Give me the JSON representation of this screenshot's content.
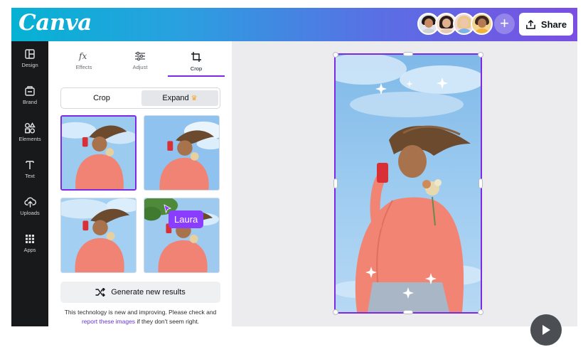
{
  "header": {
    "logo": "Canva",
    "gradient_start": "#05b2d3",
    "gradient_end": "#7a4fe2",
    "share_label": "Share",
    "share_icon": "upload-icon",
    "add_collaborator_icon": "plus-icon",
    "collaborators": [
      {
        "hair": "#1f1a17",
        "shirt": "#cfd3d8",
        "ring": "#f1a7b8"
      },
      {
        "hair": "#2a1e1a",
        "shirt": "#e8c8b8",
        "ring": "#f3c68a"
      },
      {
        "hair": "#e9c98b",
        "shirt": "#7fb5e6",
        "ring": "#f0a3b6"
      },
      {
        "hair": "#3a2a22",
        "shirt": "#f0b43c",
        "ring": "#f3c68a"
      }
    ]
  },
  "rail": {
    "items": [
      {
        "label": "Design",
        "icon": "layout-icon"
      },
      {
        "label": "Brand",
        "icon": "brand-kit-icon"
      },
      {
        "label": "Elements",
        "icon": "shapes-icon"
      },
      {
        "label": "Text",
        "icon": "text-icon"
      },
      {
        "label": "Uploads",
        "icon": "cloud-upload-icon"
      },
      {
        "label": "Apps",
        "icon": "apps-grid-icon"
      }
    ]
  },
  "panel": {
    "tabs": [
      {
        "label": "Effects",
        "icon": "fx-icon"
      },
      {
        "label": "Adjust",
        "icon": "sliders-icon"
      },
      {
        "label": "Crop",
        "icon": "crop-icon",
        "active": true
      }
    ],
    "toggle": {
      "crop_label": "Crop",
      "expand_label": "Expand",
      "expand_badge_icon": "crown-icon",
      "selected": "Expand"
    },
    "results_selected_index": 0,
    "cursor_tag": "Laura",
    "cursor_color": "#8b3dff",
    "generate_label": "Generate new results",
    "generate_icon": "shuffle-icon",
    "disclaimer_before": "This technology is new and improving. Please check and",
    "disclaimer_link": "report these images",
    "disclaimer_after": "if they don't seem right."
  },
  "canvas": {
    "selection_color": "#7d2ae8",
    "sky_color": "#8fc3ec"
  },
  "player": {
    "icon": "play-icon"
  }
}
